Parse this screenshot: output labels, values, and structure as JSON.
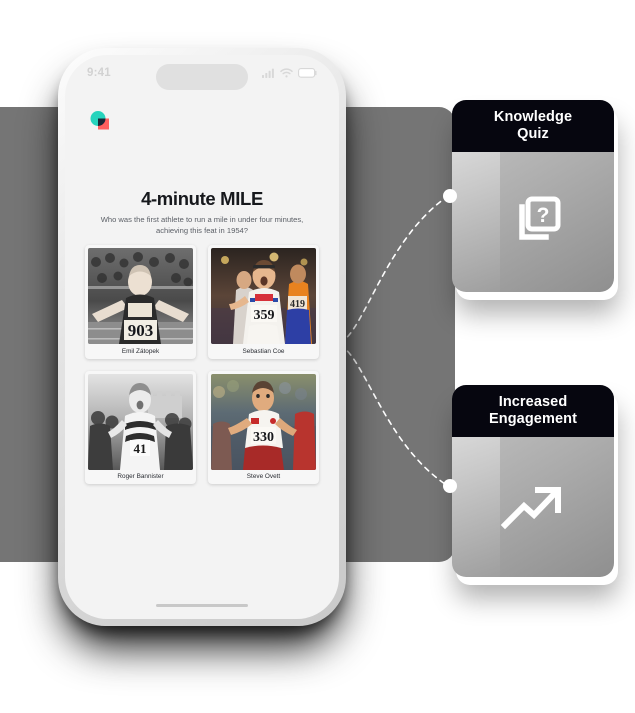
{
  "phone": {
    "status": {
      "time": "9:41",
      "cellular_icon": "signal-bars-icon",
      "wifi_icon": "wifi-icon",
      "battery_icon": "battery-icon"
    },
    "logo": {
      "name": "app-logo",
      "circle_color": "#27d3bc",
      "square_color": "#ff5f5f",
      "overlap_color": "#1b2636"
    },
    "quiz": {
      "title": "4-minute MILE",
      "question": "Who was the first athlete to run a mile in under four minutes, achieving this feat in 1954?",
      "answers": [
        {
          "name": "Emil Zátopek",
          "bib": "903",
          "photo_style": "bw"
        },
        {
          "name": "Sebastian Coe",
          "bib": "359",
          "photo_style": "color"
        },
        {
          "name": "Roger Bannister",
          "bib": "41",
          "photo_style": "bw"
        },
        {
          "name": "Steve Ovett",
          "bib": "330",
          "photo_style": "color"
        }
      ]
    },
    "home_indicator": "home-indicator"
  },
  "feature_cards": [
    {
      "title": "Knowledge\nQuiz",
      "title_line1": "Knowledge",
      "title_line2": "Quiz",
      "icon": "question-cards-icon",
      "header_color": "#06060f"
    },
    {
      "title": "Increased\nEngagement",
      "title_line1": "Increased",
      "title_line2": "Engagement",
      "icon": "trending-up-arrow-icon",
      "header_color": "#06060f"
    }
  ],
  "connectors": {
    "dot_color": "#ffffff",
    "line_style": "dashed",
    "line_color": "#ffffff"
  },
  "background": {
    "panel_color": "#757575"
  }
}
